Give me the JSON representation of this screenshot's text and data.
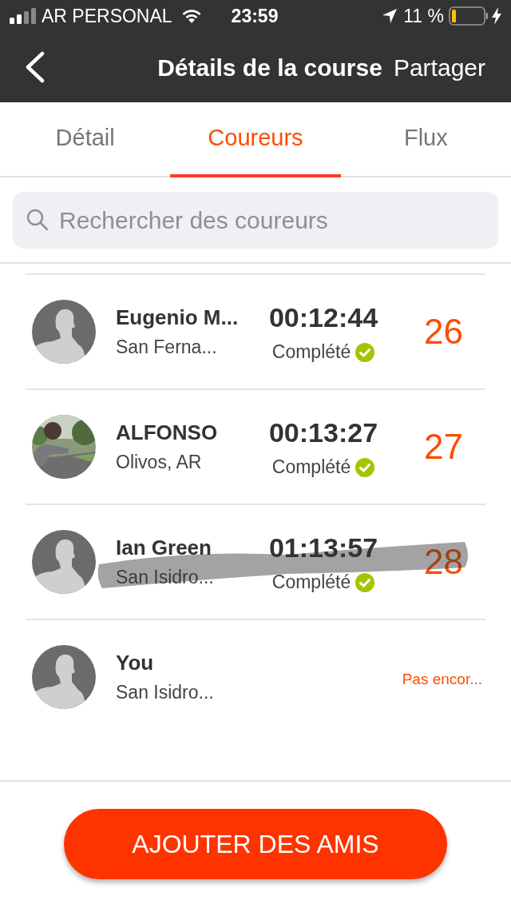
{
  "status_bar": {
    "carrier": "AR PERSONAL",
    "time": "23:59",
    "battery": "11 %"
  },
  "nav": {
    "title": "Détails de la course",
    "action": "Partager"
  },
  "tabs": [
    {
      "label": "Détail",
      "selected": false
    },
    {
      "label": "Coureurs",
      "selected": true
    },
    {
      "label": "Flux",
      "selected": false
    }
  ],
  "search": {
    "placeholder": "Rechercher des coureurs"
  },
  "runners": [
    {
      "kind": "finished",
      "has_photo": false,
      "name": "Eugenio M...",
      "location": "San Ferna...",
      "time": "00:12:44",
      "status": "Complété",
      "rank": "26",
      "scribbled": false
    },
    {
      "kind": "finished",
      "has_photo": true,
      "name": "ALFONSO",
      "location": "Olivos, AR",
      "time": "00:13:27",
      "status": "Complété",
      "rank": "27",
      "scribbled": false
    },
    {
      "kind": "finished",
      "has_photo": false,
      "name": "Ian Green",
      "location": "San Isidro...",
      "time": "01:13:57",
      "status": "Complété",
      "rank": "28",
      "scribbled": true
    },
    {
      "kind": "pending",
      "has_photo": false,
      "name": "You",
      "location": "San Isidro...",
      "status": "Pas encor..."
    }
  ],
  "footer": {
    "button": "AJOUTER DES AMIS"
  }
}
